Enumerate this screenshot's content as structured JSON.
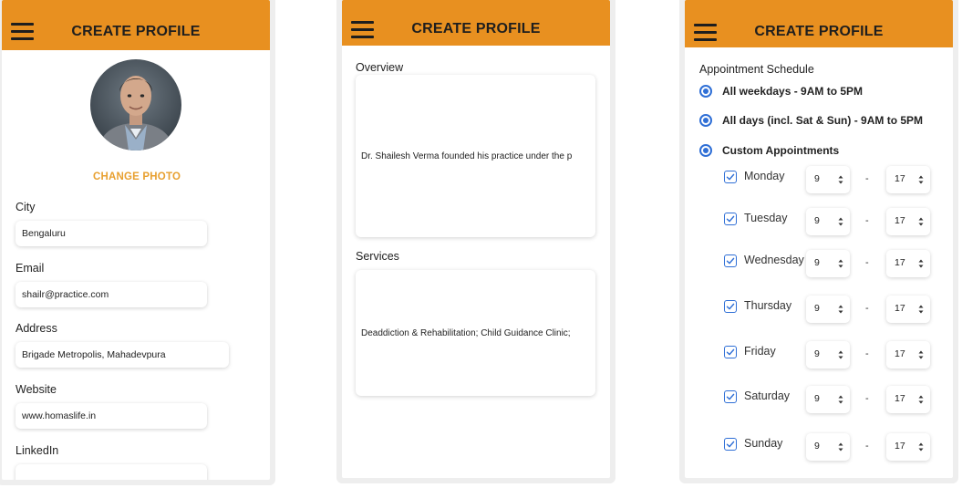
{
  "screen1": {
    "title": "CREATE PROFILE",
    "change_photo": "CHANGE PHOTO",
    "fields": [
      {
        "label": "City",
        "value": "Bengaluru"
      },
      {
        "label": "Email",
        "value": "shailr@practice.com"
      },
      {
        "label": "Address",
        "value": "Brigade Metropolis, Mahadevpura"
      },
      {
        "label": "Website",
        "value": "www.homaslife.in"
      },
      {
        "label": "LinkedIn",
        "value": ""
      }
    ]
  },
  "screen2": {
    "title": "CREATE PROFILE",
    "overview_label": "Overview",
    "overview_text": "Dr. Shailesh Verma founded his practice under the p",
    "services_label": "Services",
    "services_text": "Deaddiction & Rehabilitation; Child Guidance Clinic;"
  },
  "screen3": {
    "title": "CREATE PROFILE",
    "schedule_label": "Appointment Schedule",
    "options": [
      {
        "label": "All weekdays - 9AM to 5PM",
        "selected": true
      },
      {
        "label": "All days (incl. Sat & Sun) - 9AM to 5PM",
        "selected": true
      },
      {
        "label": "Custom Appointments",
        "selected": true
      }
    ],
    "separator": "-",
    "days": [
      {
        "name": "Monday",
        "checked": true,
        "start": "9",
        "end": "17"
      },
      {
        "name": "Tuesday",
        "checked": true,
        "start": "9",
        "end": "17"
      },
      {
        "name": "Wednesday",
        "checked": true,
        "start": "9",
        "end": "17"
      },
      {
        "name": "Thursday",
        "checked": true,
        "start": "9",
        "end": "17"
      },
      {
        "name": "Friday",
        "checked": true,
        "start": "9",
        "end": "17"
      },
      {
        "name": "Saturday",
        "checked": true,
        "start": "9",
        "end": "17"
      },
      {
        "name": "Sunday",
        "checked": true,
        "start": "9",
        "end": "17"
      }
    ],
    "edge_glyph": ":"
  },
  "colors": {
    "appbar": "#e89020",
    "accent_text": "#e8a030",
    "control_blue": "#2f6fd6"
  },
  "icons": [
    "menu-icon",
    "avatar-photo",
    "checkmark-icon",
    "spinner-arrows-icon"
  ]
}
